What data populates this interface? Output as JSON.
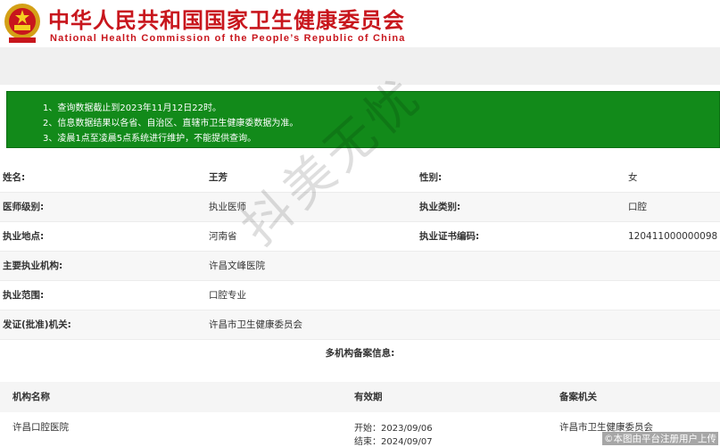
{
  "header": {
    "title_cn": "中华人民共和国国家卫生健康委员会",
    "title_en": "National Health Commission of the People’s Republic of China",
    "emblem_icon": "national-emblem-icon"
  },
  "notice": {
    "line1": "1、查询数据截止到2023年11月12日22时。",
    "line2": "2、信息数据结果以各省、自治区、直辖市卫生健康委数据为准。",
    "line3": "3、凌晨1点至凌晨5点系统进行维护，不能提供查询。"
  },
  "fields": {
    "name_label": "姓名:",
    "name_value": "王芳",
    "gender_label": "性别:",
    "gender_value": "女",
    "level_label": "医师级别:",
    "level_value": "执业医师",
    "type_label": "执业类别:",
    "type_value": "口腔",
    "place_label": "执业地点:",
    "place_value": "河南省",
    "cert_label": "执业证书编码:",
    "cert_value": "120411000000098",
    "org_label": "主要执业机构:",
    "org_value": "许昌文峰医院",
    "scope_label": "执业范围:",
    "scope_value": "口腔专业",
    "issuer_label": "发证(批准)机关:",
    "issuer_value": "许昌市卫生健康委员会"
  },
  "multi": {
    "title": "多机构备案信息:",
    "col_org": "机构名称",
    "col_valid": "有效期",
    "col_authority": "备案机关",
    "rows": [
      {
        "org": "许昌口腔医院",
        "start": "开始：2023/09/06",
        "end": "结束：2024/09/07",
        "authority": "许昌市卫生健康委员会"
      }
    ]
  },
  "watermark": "抖美无忧",
  "corner_caption": "©本图由平台注册用户上传",
  "colors": {
    "brand_red": "#c8161d",
    "notice_green": "#128a1a"
  }
}
